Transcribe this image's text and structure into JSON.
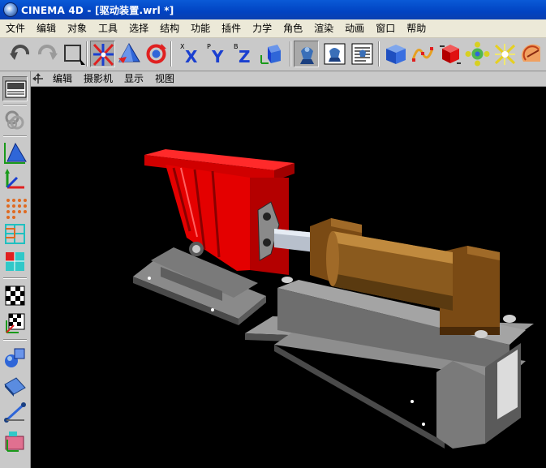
{
  "window": {
    "title": "CINEMA 4D - [驱动装置.wrl *]"
  },
  "menu": {
    "items": [
      "文件",
      "编辑",
      "对象",
      "工具",
      "选择",
      "结构",
      "功能",
      "插件",
      "力学",
      "角色",
      "渲染",
      "动画",
      "窗口",
      "帮助"
    ]
  },
  "toolbar": {
    "icons": [
      "undo-icon",
      "redo-icon",
      "select-rect-icon",
      "move-icon",
      "scale-icon",
      "rotate-icon",
      "x-axis-icon",
      "y-axis-icon",
      "z-axis-icon",
      "world-coords-icon",
      "render-view-icon",
      "render-region-icon",
      "render-settings-icon",
      "cube-primitive-icon",
      "spline-icon",
      "nurbs-icon",
      "modeling-icon",
      "deformer-icon",
      "scene-icon"
    ]
  },
  "viewport": {
    "menu": [
      "编辑",
      "摄影机",
      "显示",
      "视图"
    ]
  },
  "colors": {
    "titlebar": "#0a4bc8",
    "ui_gray": "#c9c9c9",
    "red_part": "#e00000",
    "bronze_part": "#8a5a1e",
    "steel_part": "#6e6e6e"
  }
}
